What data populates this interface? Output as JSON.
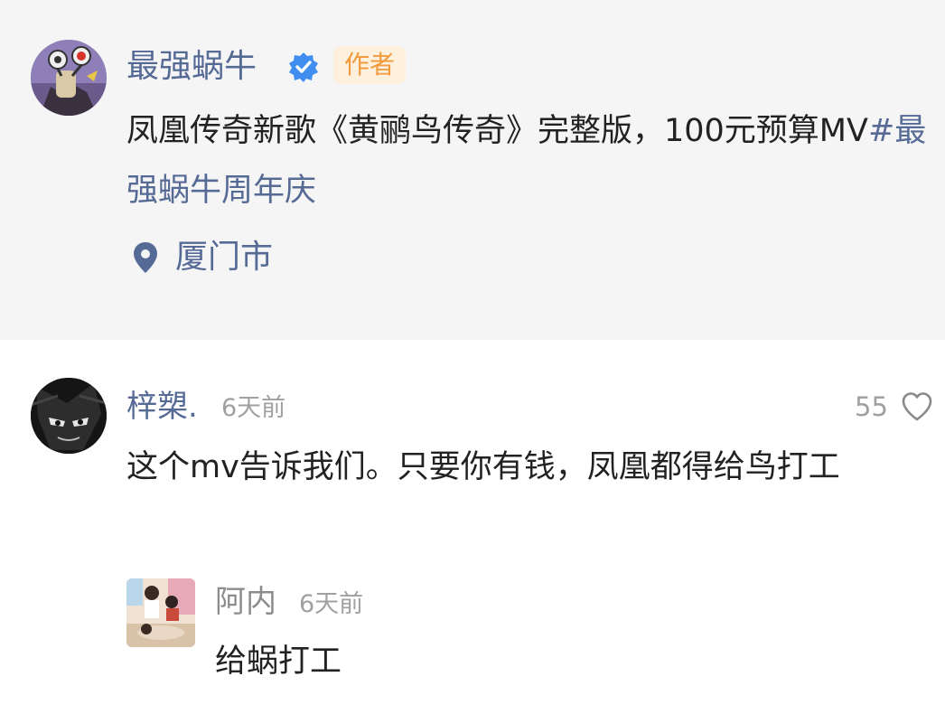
{
  "post": {
    "author_name": "最强蜗牛",
    "verified_icon": "verified-check-icon",
    "author_badge": "作者",
    "text_main": "凤凰传奇新歌《黄鹂鸟传奇》完整版，100元预算MV",
    "hashtag": "#最强蜗牛周年庆",
    "location_icon": "location-pin-icon",
    "location": "厦门市"
  },
  "comment": {
    "author_name": "梓槊.",
    "time": "6天前",
    "likes": "55",
    "like_icon": "heart-outline-icon",
    "text": "这个mv告诉我们。只要你有钱，凤凰都得给鸟打工",
    "reply": {
      "author_name": "阿内",
      "time": "6天前",
      "text": "给蜗打工"
    }
  },
  "colors": {
    "name_blue": "#566a96",
    "badge_orange": "#f29a3c",
    "badge_bg": "#fdf0dd",
    "card_bg": "#f5f5f5",
    "meta_gray": "#a0a0a0",
    "verified_blue": "#3f8ef0"
  }
}
